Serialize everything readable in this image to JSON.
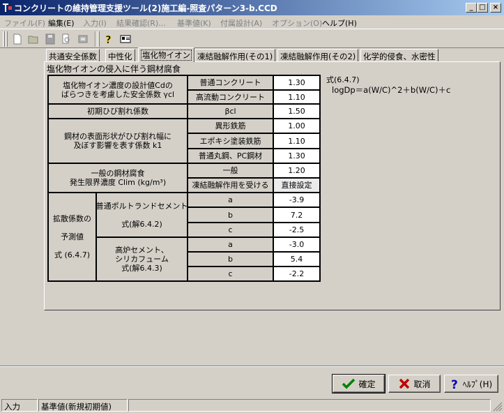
{
  "window": {
    "title": "コンクリートの維持管理支援ツール(2)施工編-照査パターン3-b.CCD",
    "minimize_glyph": "_",
    "maximize_glyph": "□",
    "close_glyph": "×"
  },
  "menu": {
    "items": [
      {
        "label": "ファイル(F)",
        "enabled": false
      },
      {
        "label": "編集(E)",
        "enabled": true
      },
      {
        "label": "入力(I)",
        "enabled": false
      },
      {
        "label": "結果確認(R)...",
        "enabled": false
      },
      {
        "label": "基準値(K)",
        "enabled": false
      },
      {
        "label": "付属設計(A)",
        "enabled": false
      },
      {
        "label": "オプション(O)",
        "enabled": false
      },
      {
        "label": "ヘルプ(H)",
        "enabled": true
      }
    ]
  },
  "tabs": [
    {
      "label": "共通安全係数",
      "active": false
    },
    {
      "label": "中性化",
      "active": false
    },
    {
      "label": "塩化物イオン",
      "active": true
    },
    {
      "label": "凍結融解作用(その1)",
      "active": false
    },
    {
      "label": "凍結融解作用(その2)",
      "active": false
    },
    {
      "label": "化学的侵食、水密性",
      "active": false
    }
  ],
  "panel": {
    "section_title": "塩化物イオンの侵入に伴う鋼材腐食",
    "formula_ref": "式(6.4.7)",
    "formula": "logDp＝a(W/C)^2＋b(W/C)＋c"
  },
  "table": {
    "r1_label": "塩化物イオン濃度の設計値Cdの\nばらつきを考慮した安全係数 γcl",
    "r1_sub1": "普通コンクリート",
    "r1_v1": "1.30",
    "r1_sub2": "高流動コンクリート",
    "r1_v2": "1.10",
    "r2_label": "初期ひび割れ係数",
    "r2_sub": "βcl",
    "r2_v": "1.50",
    "r3_label": "鋼材の表面形状がひび割れ幅に\n及ぼす影響を表す係数 k1",
    "r3_sub1": "異形鉄筋",
    "r3_v1": "1.00",
    "r3_sub2": "エポキシ塗装鉄筋",
    "r3_v2": "1.10",
    "r3_sub3": "普通丸鋼、PC鋼材",
    "r3_v3": "1.30",
    "r4_label": "一般の鋼材腐食\n発生限界濃度 Clim (kg/m³)",
    "r4_sub1": "一般",
    "r4_v1": "1.20",
    "r4_sub2": "凍結融解作用を受ける",
    "r4_v2": "直接設定",
    "r5_label": "拡散係数の\n\n予測値\n\n式 (6.4.7)",
    "grp1_label": "普通ポルトランドセメント\n\n式(解6.4.2)",
    "grp2_label": "高炉セメント、\nシリカフューム\n式(解6.4.3)",
    "a": "a",
    "b": "b",
    "c": "c",
    "g1_a": "-3.9",
    "g1_b": "7.2",
    "g1_c": "-2.5",
    "g2_a": "-3.0",
    "g2_b": "5.4",
    "g2_c": "-2.2"
  },
  "buttons": {
    "ok": "確定",
    "cancel": "取消",
    "help": "ﾍﾙﾌﾟ(H)"
  },
  "status": {
    "mode": "入力",
    "basis": "基準値(新規初期値)"
  },
  "colors": {
    "title_start": "#0a246a",
    "title_end": "#a6caf0",
    "ok_check": "#008000",
    "cancel_x": "#c00000",
    "help_q": "#0000c0"
  }
}
